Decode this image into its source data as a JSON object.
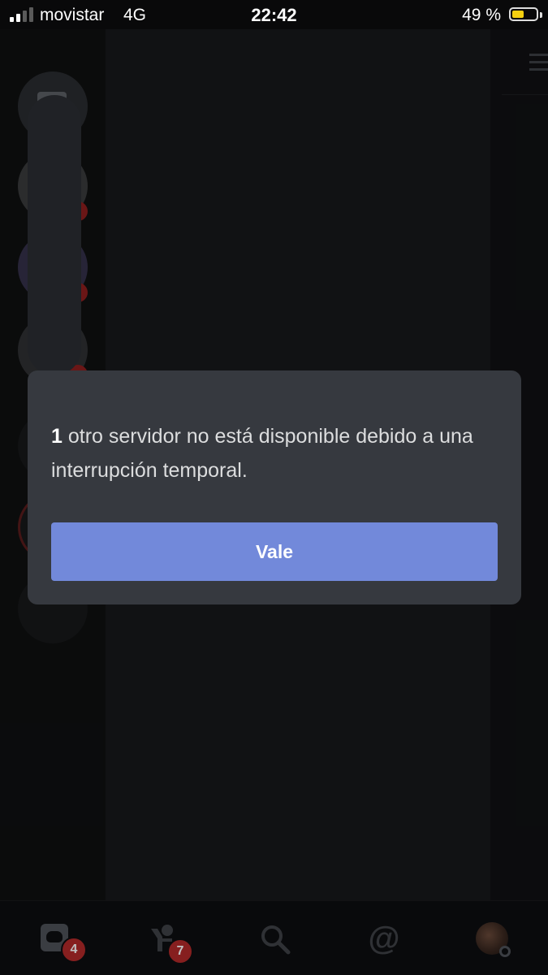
{
  "status_bar": {
    "carrier": "movistar",
    "network": "4G",
    "time": "22:42",
    "battery_percent": "49 %",
    "battery_level": 0.49,
    "battery_color": "#f5d010"
  },
  "modal": {
    "count": "1",
    "message": " otro servidor no está disponible debido a una interrupción temporal.",
    "button_label": "Vale",
    "button_color": "#7289da",
    "background_color": "#36393f"
  },
  "tab_bar": {
    "home_badge": "4",
    "friends_badge": "7",
    "tabs": [
      "home-icon",
      "friends-icon",
      "search-icon",
      "mention-icon",
      "avatar"
    ],
    "badge_color": "#b32a2a"
  },
  "background": {
    "icons": [
      "chat-bubble-icon",
      "hamburger-menu-icon"
    ]
  }
}
